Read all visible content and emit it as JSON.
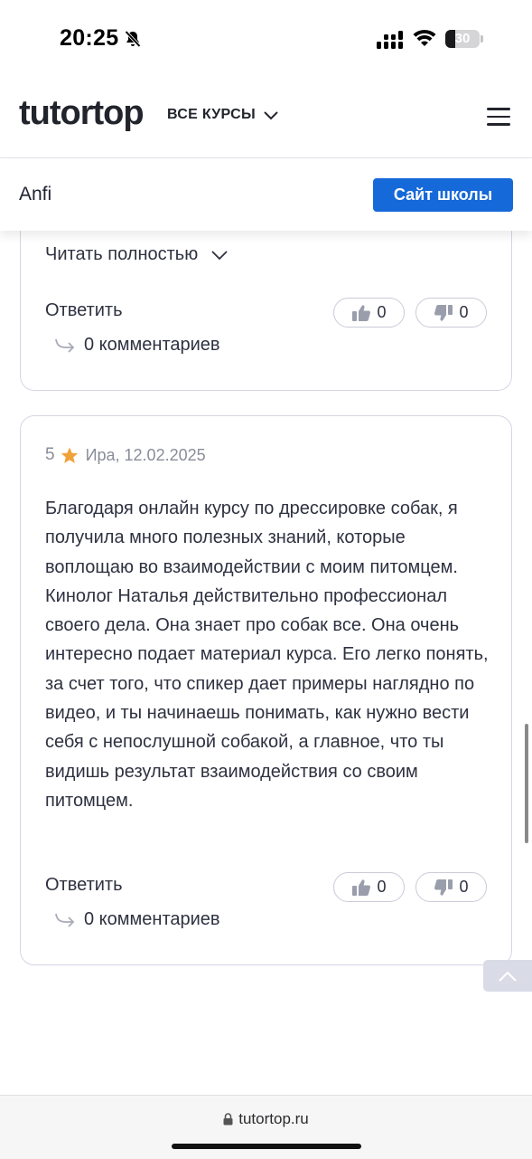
{
  "status_bar": {
    "time": "20:25",
    "battery": "30",
    "battery_level": 0.3
  },
  "header": {
    "logo": "tutortop",
    "courses_menu": "ВСЕ КУРСЫ"
  },
  "school_bar": {
    "name": "Anfi",
    "button": "Сайт школы"
  },
  "review_1": {
    "read_more": "Читать полностью",
    "reply": "Ответить",
    "likes": "0",
    "dislikes": "0",
    "comments": "0 комментариев"
  },
  "review_2": {
    "rating": "5",
    "meta": "Ира, 12.02.2025",
    "text": "Благодаря онлайн курсу по дрессировке собак, я получила много полезных знаний, которые воплощаю во взаимодействии с моим питомцем. Кинолог Наталья действительно профессионал своего дела. Она знает про собак все. Она очень интересно подает материал курса. Его легко понять, за счет того, что спикер дает примеры наглядно по видео, и ты начинаешь понимать, как нужно вести себя с непослушной собакой, а главное, что ты видишь результат взаимодействия со своим питомцем.",
    "reply": "Ответить",
    "likes": "0",
    "dislikes": "0",
    "comments": "0 комментариев"
  },
  "browser": {
    "url": "tutortop.ru"
  },
  "colors": {
    "accent": "#1669d8",
    "star": "#f0a23a",
    "card_border": "#d4d6e4"
  }
}
